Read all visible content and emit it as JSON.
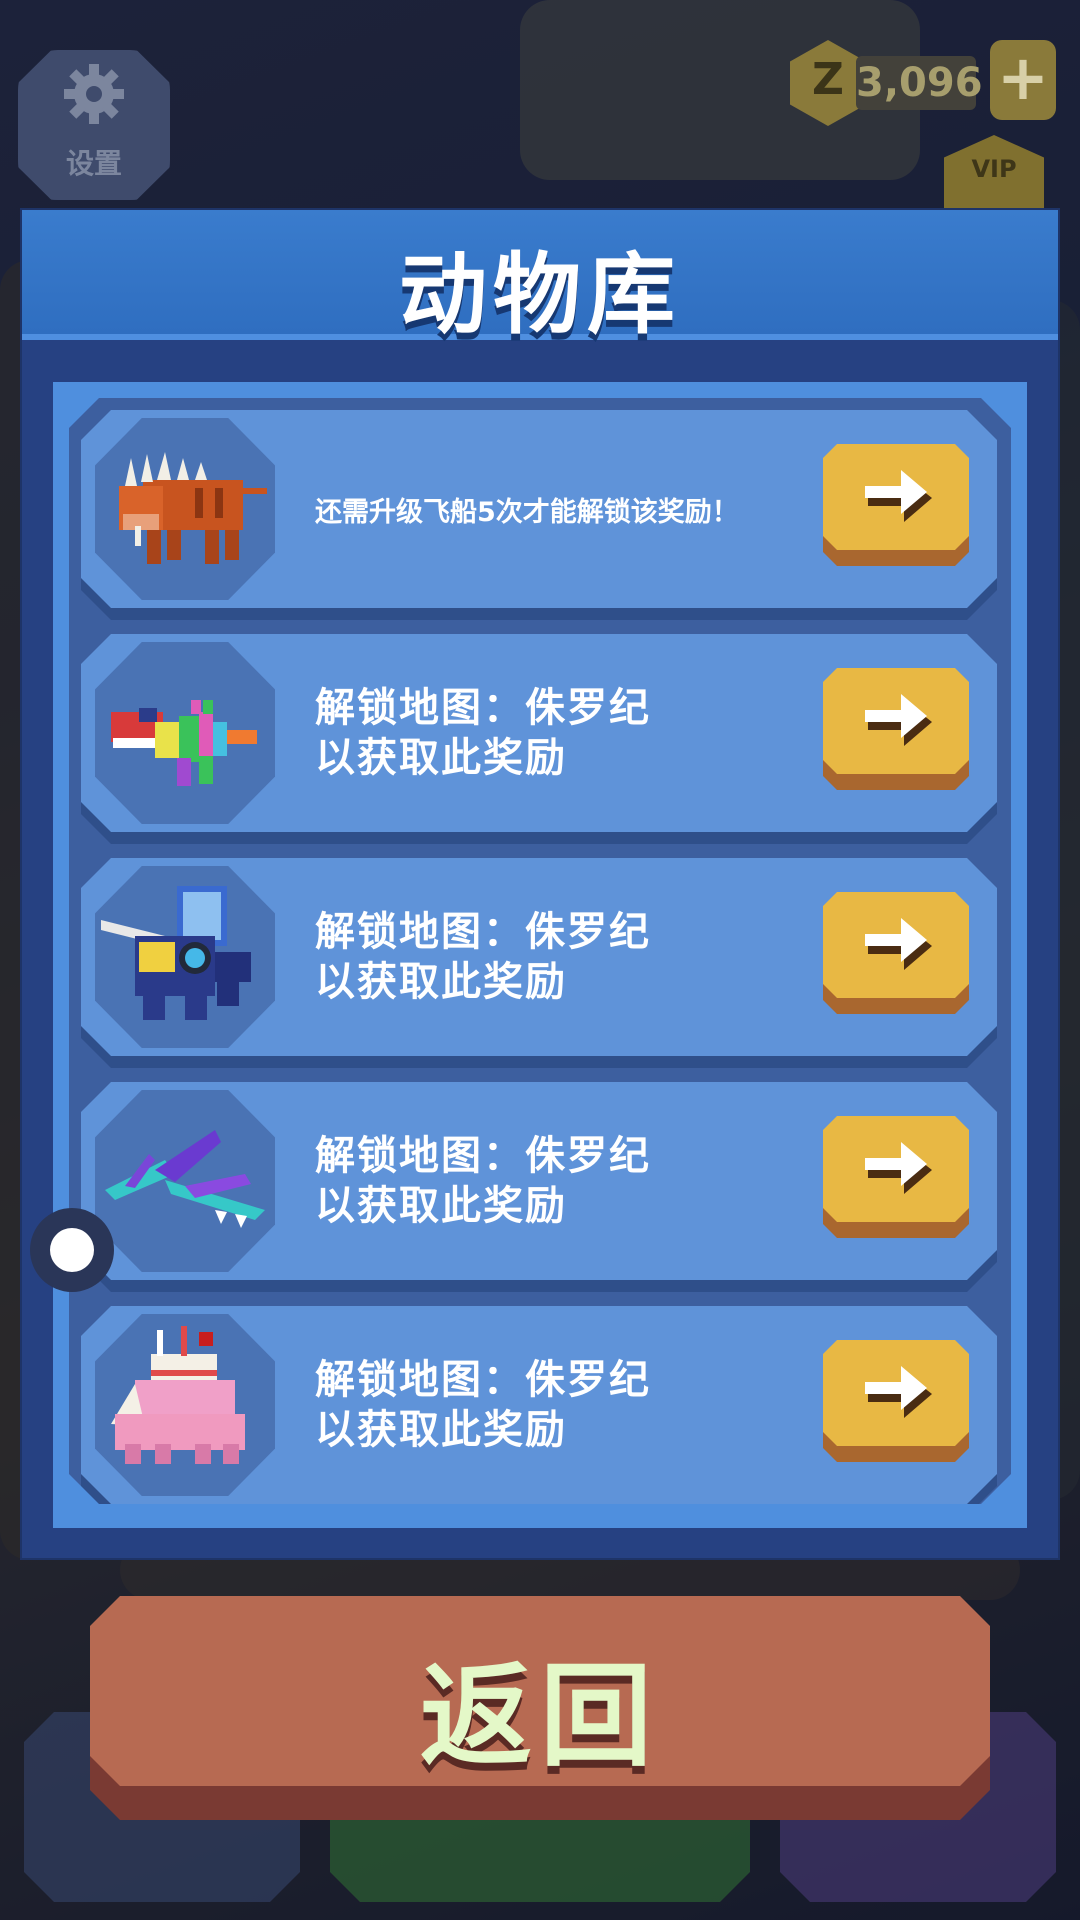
{
  "settings": {
    "label": "设置"
  },
  "currency": {
    "symbol": "Z",
    "amount": "3,096",
    "plus": "+"
  },
  "vip": {
    "label": "VIP"
  },
  "dialog": {
    "title": "动物库",
    "rows": [
      {
        "animal": "orange-spiked-lion",
        "text": "还需升级飞船5次才能解锁该奖励！"
      },
      {
        "animal": "rainbow-raptor",
        "text": "解锁地图：侏罗纪\n以获取此奖励"
      },
      {
        "animal": "armored-knight-beast",
        "text": "解锁地图：侏罗纪\n以获取此奖励"
      },
      {
        "animal": "teal-pterosaur",
        "text": "解锁地图：侏罗纪\n以获取此奖励"
      },
      {
        "animal": "cake-stegosaurus",
        "text": "解锁地图：侏罗纪\n以获取此奖励"
      }
    ]
  },
  "back_button": {
    "label": "返回"
  },
  "colors": {
    "accent_gold": "#e8b844",
    "panel_blue": "#264182",
    "header_blue": "#3a7ccd",
    "back_red": "#b76a52"
  }
}
